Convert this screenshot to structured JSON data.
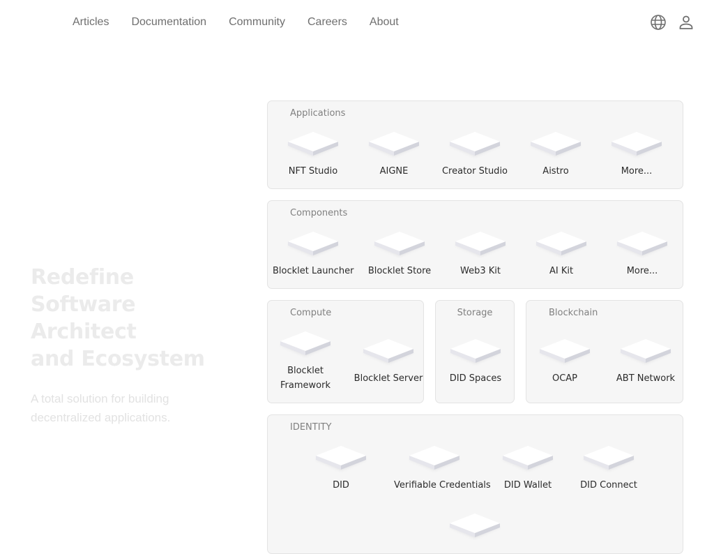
{
  "nav": {
    "links": [
      "Articles",
      "Documentation",
      "Community",
      "Careers",
      "About"
    ],
    "icons": [
      "globe-icon",
      "user-icon"
    ]
  },
  "hero": {
    "title_lines": [
      "Redefine Software",
      "Architect",
      "and Ecosystem"
    ],
    "subtitle": "A total solution for building decentralized applications."
  },
  "sections": {
    "applications": {
      "title": "Applications",
      "items": [
        "NFT Studio",
        "AIGNE",
        "Creator Studio",
        "Aistro",
        "More..."
      ]
    },
    "components": {
      "title": "Components",
      "items": [
        "Blocklet Launcher",
        "Blocklet Store",
        "Web3 Kit",
        "AI Kit",
        "More..."
      ]
    },
    "compute": {
      "title": "Compute",
      "items": [
        "Blocklet Framework",
        "Blocklet Server"
      ]
    },
    "storage": {
      "title": "Storage",
      "items": [
        "DID Spaces"
      ]
    },
    "blockchain": {
      "title": "Blockchain",
      "items": [
        "OCAP",
        "ABT Network"
      ]
    },
    "identity": {
      "title": "IDENTITY",
      "items": [
        "DID",
        "Verifiable Credentials",
        "DID Wallet",
        "DID Connect",
        ""
      ]
    }
  },
  "colors": {
    "card_bg": "#f6f6f6",
    "card_border": "#e3e3e3",
    "nav_text": "#6f6f6f",
    "hero_text": "#ebebeb"
  }
}
